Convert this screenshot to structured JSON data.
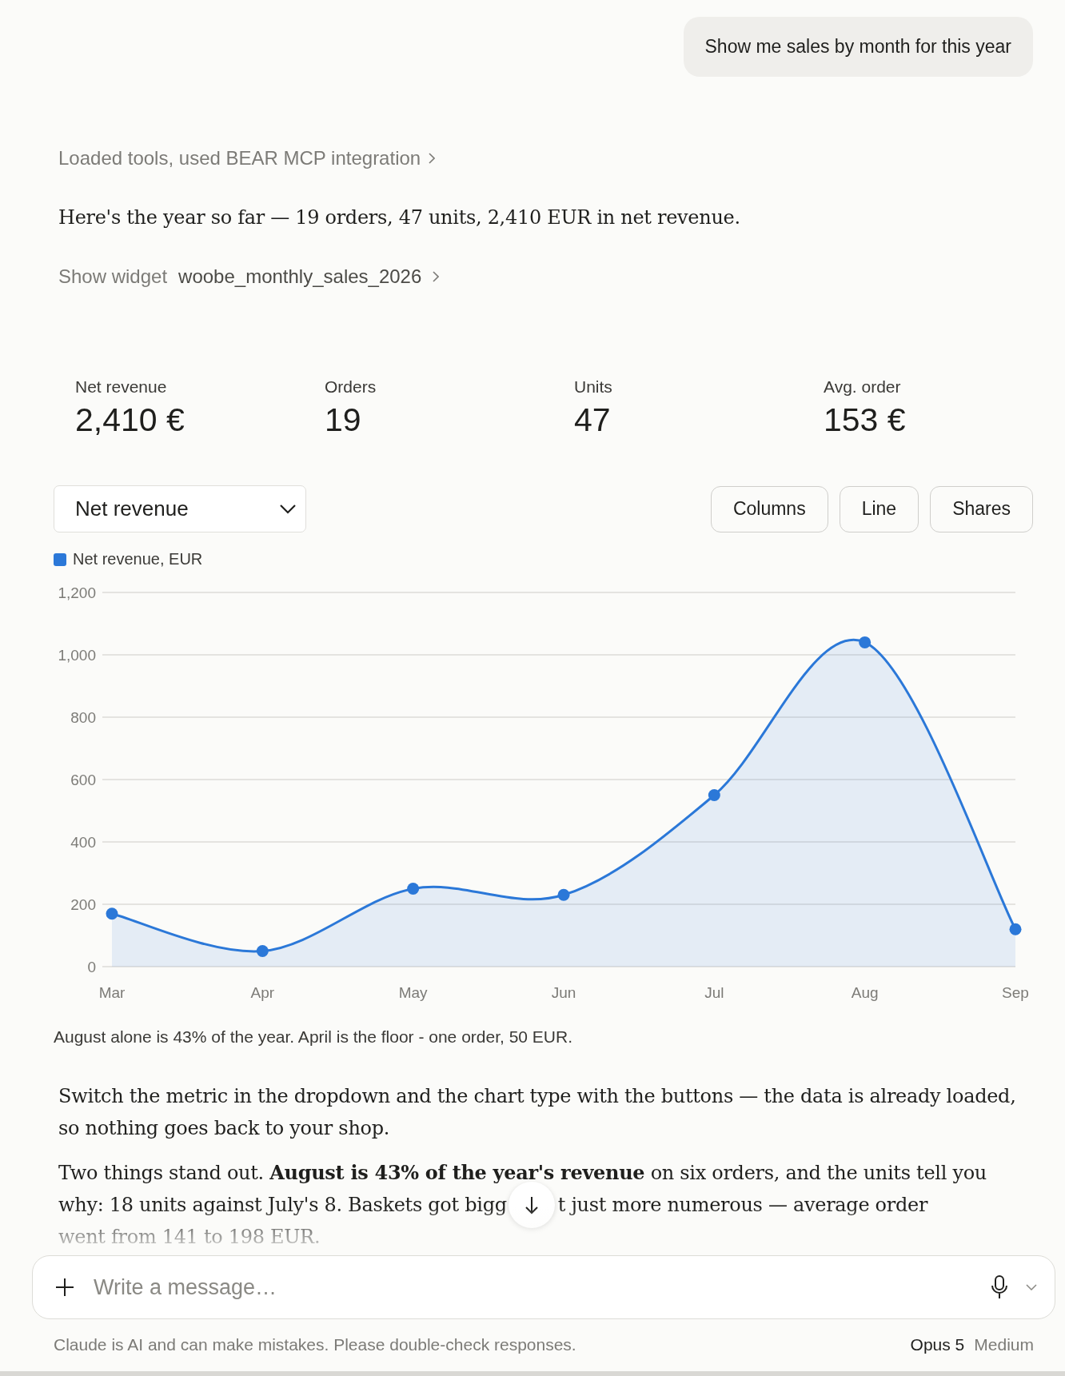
{
  "user_message": {
    "text": "Show me sales by month for this year"
  },
  "assistant": {
    "tool_summary": "Loaded tools, used BEAR MCP integration",
    "intro": "Here's the year so far — 19 orders, 47 units, 2,410 EUR in net revenue.",
    "widget_link": {
      "label": "Show widget",
      "name": "woobe_monthly_sales_2026"
    },
    "widget": {
      "stats": [
        {
          "label": "Net revenue",
          "value": "2,410 €"
        },
        {
          "label": "Orders",
          "value": "19"
        },
        {
          "label": "Units",
          "value": "47"
        },
        {
          "label": "Avg. order",
          "value": "153 €"
        }
      ],
      "metric_select": {
        "value": "Net revenue"
      },
      "chart_types": [
        {
          "label": "Columns"
        },
        {
          "label": "Line"
        },
        {
          "label": "Shares"
        }
      ],
      "chart_data": {
        "type": "area",
        "categories": [
          "Mar",
          "Apr",
          "May",
          "Jun",
          "Jul",
          "Aug",
          "Sep"
        ],
        "series": [
          {
            "name": "Net revenue, EUR",
            "color": "#2b78d8",
            "values": [
              170,
              50,
              250,
              230,
              550,
              1040,
              120
            ]
          }
        ],
        "ylim": [
          0,
          1200
        ],
        "grid": true,
        "yticks": [
          0,
          200,
          400,
          600,
          800,
          {
            "value": 1000,
            "label": "1,000"
          },
          {
            "value": 1200,
            "label": "1,200"
          }
        ]
      },
      "caption": "August alone is 43% of the year. April is the floor - one order, 50 EUR."
    },
    "paragraphs": [
      {
        "kind": "text",
        "text": "Switch the metric in the dropdown and the chart type with the buttons — the data is already loaded, so nothing goes back to your shop."
      },
      {
        "kind": "lines",
        "lines": [
          [
            "Two things stand out. **August is 43% of the year's revenue** on six orders, and the units tell you"
          ],
          [
            "why: 18 units against July's 8. Baskets got bigg",
            "t just more numerous — average order"
          ],
          [
            "went from 141 to 198 EUR."
          ]
        ]
      }
    ]
  },
  "composer": {
    "placeholder": "Write a message…"
  },
  "footer": {
    "disclaimer": "Claude is AI and can make mistakes. Please double-check responses.",
    "model": "Opus 5",
    "effort": "Medium"
  }
}
